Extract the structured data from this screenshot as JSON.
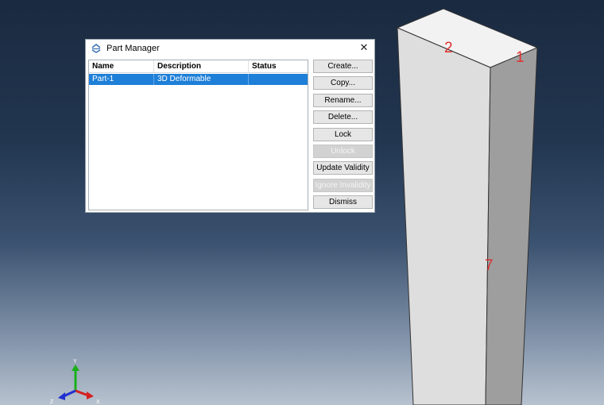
{
  "dialog": {
    "title": "Part Manager",
    "columns": [
      "Name",
      "Description",
      "Status"
    ],
    "rows": [
      {
        "name": "Part-1",
        "description": "3D Deformable",
        "status": ""
      }
    ],
    "buttons": {
      "create": "Create...",
      "copy": "Copy...",
      "rename": "Rename...",
      "delete": "Delete...",
      "lock": "Lock",
      "unlock": "Unlock",
      "update_validity": "Update Validity",
      "ignore_invalidity": "Ignore Invalidity",
      "dismiss": "Dismiss"
    }
  },
  "model_labels": {
    "edge_top": "2",
    "corner": "1",
    "edge_vertical": "7"
  },
  "triad": {
    "x": "X",
    "y": "Y",
    "z": "Z"
  },
  "colors": {
    "selection": "#1e7fd8",
    "annotation": "#e03030",
    "axis_x": "#d62020",
    "axis_y": "#18b018",
    "axis_z": "#2030d0"
  }
}
